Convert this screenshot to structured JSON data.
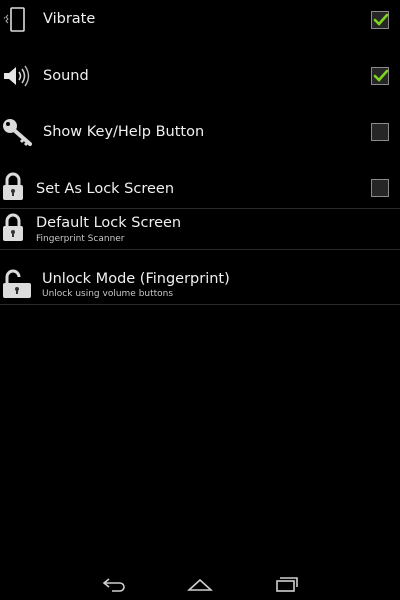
{
  "settings": {
    "vibrate": {
      "label": "Vibrate",
      "checked": true,
      "icon": "phone-vibrate-icon"
    },
    "sound": {
      "label": "Sound",
      "checked": true,
      "icon": "speaker-icon"
    },
    "show_key": {
      "label": "Show Key/Help Button",
      "checked": false,
      "icon": "key-icon"
    },
    "lock_screen": {
      "label": "Set As Lock Screen",
      "checked": false,
      "icon": "lock-icon"
    },
    "default_lock": {
      "label": "Default Lock Screen",
      "summary": "Fingerprint Scanner",
      "icon": "lock-icon"
    },
    "unlock_mode": {
      "label": "Unlock Mode (Fingerprint)",
      "summary": "Unlock using volume buttons",
      "icon": "unlock-icon"
    }
  },
  "navbar": {
    "back": "back-icon",
    "home": "home-icon",
    "recents": "recents-icon"
  },
  "colors": {
    "check": "#7ed321",
    "background": "#000000"
  }
}
